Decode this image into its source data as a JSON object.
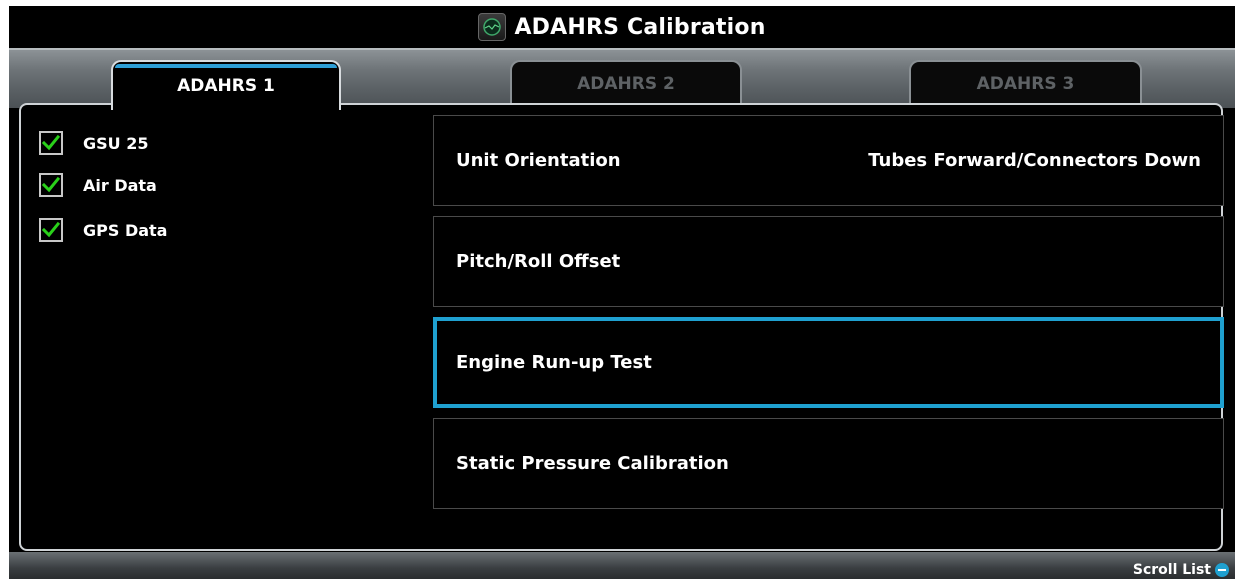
{
  "window": {
    "title": "ADAHRS Calibration",
    "title_icon": "attitude-indicator-icon"
  },
  "tabs": [
    {
      "label": "ADAHRS 1",
      "state": "active"
    },
    {
      "label": "ADAHRS 2",
      "state": "inactive"
    },
    {
      "label": "ADAHRS 3",
      "state": "inactive"
    }
  ],
  "status_list": [
    {
      "label": "GSU 25",
      "checked": true
    },
    {
      "label": "Air Data",
      "checked": true
    },
    {
      "label": "GPS Data",
      "checked": true
    }
  ],
  "menu": [
    {
      "label": "Unit Orientation",
      "value": "Tubes Forward/Connectors Down",
      "selected": false
    },
    {
      "label": "Pitch/Roll Offset",
      "value": "",
      "selected": false
    },
    {
      "label": "Engine Run-up Test",
      "value": "",
      "selected": true
    },
    {
      "label": "Static Pressure Calibration",
      "value": "",
      "selected": false
    }
  ],
  "footer": {
    "scroll_hint": "Scroll List",
    "scroll_icon": "knob-scroll-icon"
  },
  "colors": {
    "accent": "#1fa0d0",
    "check": "#2ad11a",
    "tab_highlight": "#2e9fd6"
  }
}
